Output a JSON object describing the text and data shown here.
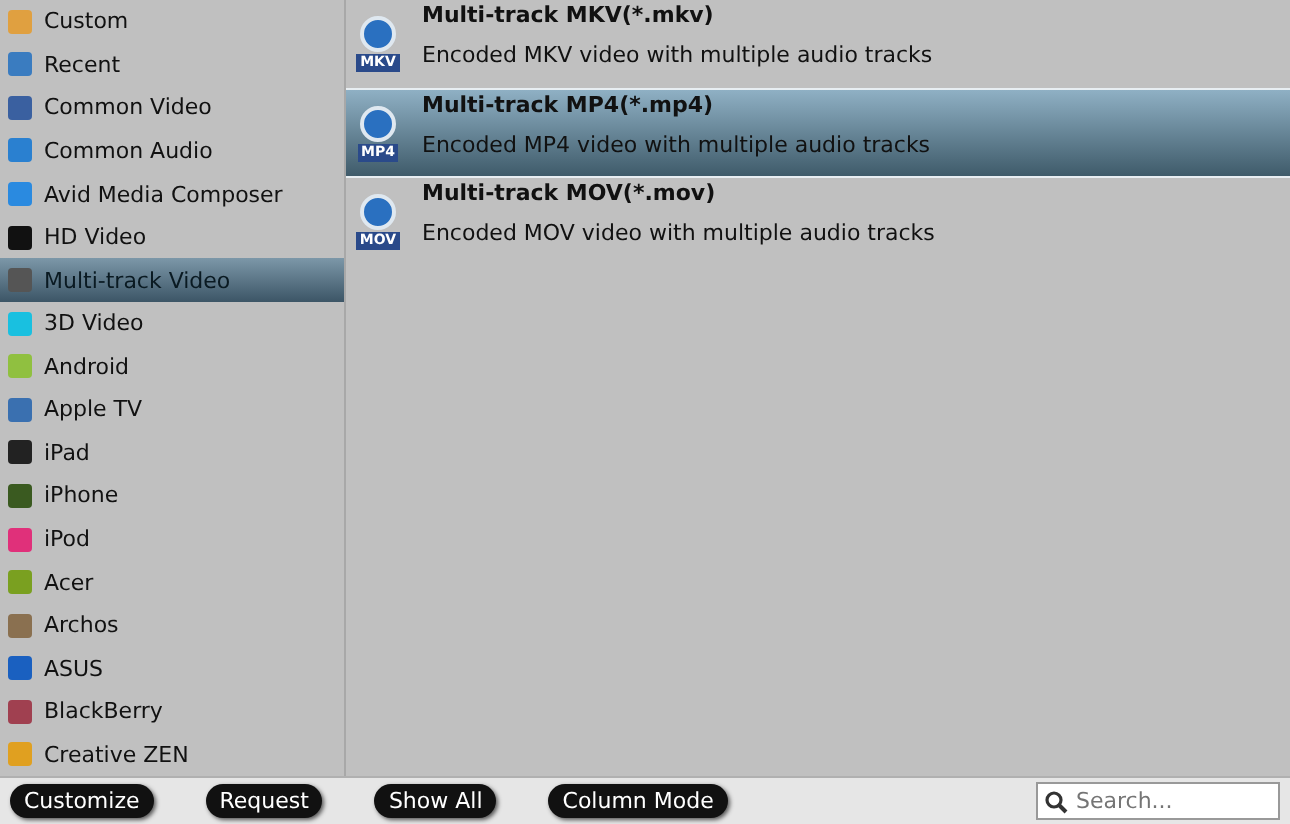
{
  "sidebar": {
    "items": [
      {
        "label": "Custom",
        "selected": false
      },
      {
        "label": "Recent",
        "selected": false
      },
      {
        "label": "Common Video",
        "selected": false
      },
      {
        "label": "Common Audio",
        "selected": false
      },
      {
        "label": "Avid Media Composer",
        "selected": false
      },
      {
        "label": "HD Video",
        "selected": false
      },
      {
        "label": "Multi-track Video",
        "selected": true
      },
      {
        "label": "3D Video",
        "selected": false
      },
      {
        "label": "Android",
        "selected": false
      },
      {
        "label": "Apple TV",
        "selected": false
      },
      {
        "label": "iPad",
        "selected": false
      },
      {
        "label": "iPhone",
        "selected": false
      },
      {
        "label": "iPod",
        "selected": false
      },
      {
        "label": "Acer",
        "selected": false
      },
      {
        "label": "Archos",
        "selected": false
      },
      {
        "label": "ASUS",
        "selected": false
      },
      {
        "label": "BlackBerry",
        "selected": false
      },
      {
        "label": "Creative ZEN",
        "selected": false
      }
    ]
  },
  "formats": [
    {
      "title": "Multi-track MKV(*.mkv)",
      "description": "Encoded MKV video with multiple audio tracks",
      "badge": "MKV",
      "selected": false
    },
    {
      "title": "Multi-track MP4(*.mp4)",
      "description": "Encoded MP4 video with multiple audio tracks",
      "badge": "MP4",
      "selected": true
    },
    {
      "title": "Multi-track MOV(*.mov)",
      "description": "Encoded MOV video with multiple audio tracks",
      "badge": "MOV",
      "selected": false
    }
  ],
  "buttons": [
    "Customize",
    "Request",
    "Show All",
    "Column Mode"
  ],
  "search": {
    "placeholder": "Search..."
  }
}
